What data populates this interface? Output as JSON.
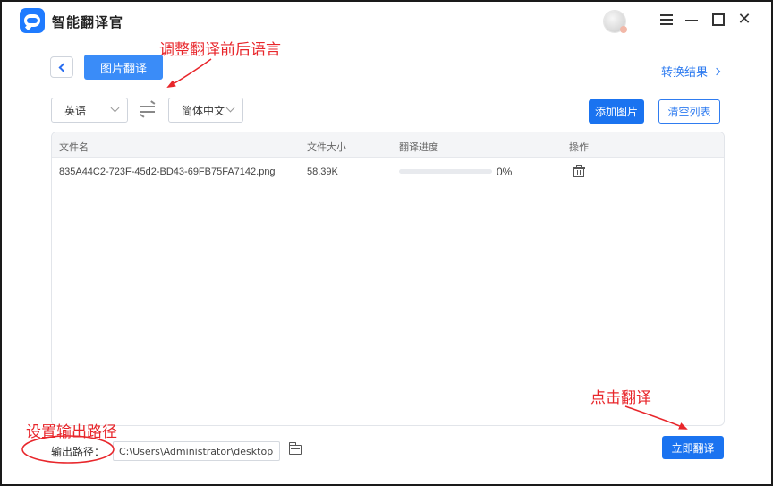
{
  "app": {
    "title": "智能翻译官"
  },
  "header": {
    "mode_label": "图片翻译",
    "result_link": "转换结果"
  },
  "languages": {
    "source": "英语",
    "target": "简体中文"
  },
  "actions": {
    "add_image": "添加图片",
    "clear_list": "清空列表",
    "translate": "立即翻译"
  },
  "table": {
    "columns": [
      "文件名",
      "文件大小",
      "翻译进度",
      "操作"
    ],
    "rows": [
      {
        "filename": "835A44C2-723F-45d2-BD43-69FB75FA7142.png",
        "size": "58.39K",
        "progress_percent": 0,
        "progress_text": "0%"
      }
    ]
  },
  "output": {
    "label": "输出路径：",
    "path": "C:\\Users\\Administrator\\desktop"
  },
  "annotations": {
    "lang_hint": "调整翻译前后语言",
    "path_hint": "设置输出路径",
    "translate_hint": "点击翻译"
  },
  "colors": {
    "accent": "#1a73f0",
    "annotation": "#e8262b"
  },
  "icons": [
    "app-logo-icon",
    "avatar",
    "menu-icon",
    "minimize-icon",
    "maximize-icon",
    "close-icon",
    "back-icon",
    "swap-icon",
    "chevron-right-icon",
    "delete-icon",
    "folder-icon"
  ]
}
